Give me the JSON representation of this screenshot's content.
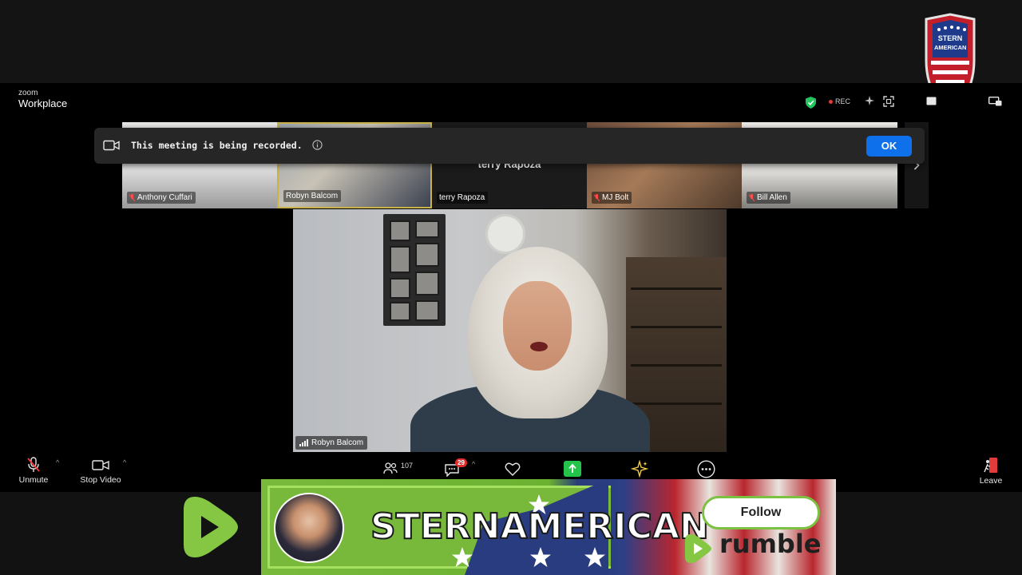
{
  "app": {
    "brand_small": "zoom",
    "brand_big": "Workplace"
  },
  "status": {
    "rec_label": "REC"
  },
  "banner": {
    "message": "This meeting is being recorded.",
    "ok_label": "OK"
  },
  "thumbnails": [
    {
      "name": "Anthony Cuffari",
      "muted": true
    },
    {
      "name": "Robyn Balcom",
      "muted": false
    },
    {
      "name": "terry Rapoza",
      "muted": false,
      "center_name": "terry Rapoza"
    },
    {
      "name": "MJ Bolt",
      "muted": true
    },
    {
      "name": "Bill Allen",
      "muted": true
    }
  ],
  "speaker": {
    "name": "Robyn Balcom"
  },
  "toolbar": {
    "unmute_label": "Unmute",
    "stop_video_label": "Stop Video",
    "participants_count": "107",
    "chat_badge": "29",
    "leave_label": "Leave"
  },
  "channel": {
    "shield_top": "STERN",
    "shield_bottom": "AMERICAN"
  },
  "ad": {
    "brand": "STERNAMERICAN",
    "follow_label": "Follow",
    "platform": "rumble"
  },
  "colors": {
    "zoom_blue": "#0e71eb",
    "rumble_green": "#85c742",
    "rec_red": "#e53935",
    "share_green": "#24c44b"
  }
}
